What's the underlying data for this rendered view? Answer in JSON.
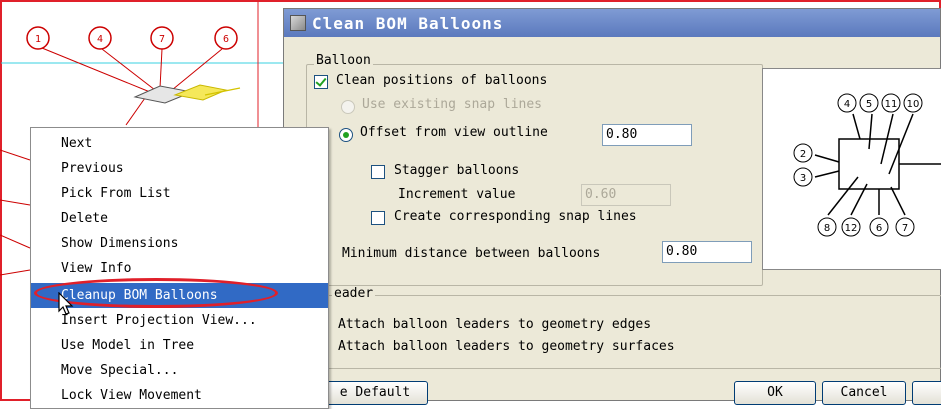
{
  "background": {
    "balloon_numbers": [
      "1",
      "4",
      "7",
      "6"
    ]
  },
  "dialog": {
    "title": "Clean BOM Balloons",
    "balloon_group": {
      "label": "Balloon",
      "clean_positions": {
        "label": "Clean positions of balloons",
        "checked": true
      },
      "use_existing_snap_lines": {
        "label": "Use existing snap lines",
        "enabled": false
      },
      "offset_from_view_outline": {
        "label": "Offset from view outline",
        "selected": true,
        "value": "0.80"
      },
      "stagger_balloons": {
        "label": "Stagger balloons",
        "checked": false
      },
      "increment_value": {
        "label": "Increment value",
        "value": "0.60",
        "enabled": false
      },
      "create_snap_lines": {
        "label": "Create corresponding snap lines",
        "checked": false
      },
      "minimum_distance": {
        "label": "Minimum distance between balloons",
        "value": "0.80"
      }
    },
    "preview": {
      "balloons_top": [
        "4",
        "5",
        "11",
        "10"
      ],
      "balloons_left": [
        "2",
        "3"
      ],
      "balloons_bottom": [
        "8",
        "12",
        "6",
        "7"
      ]
    },
    "leader_group": {
      "label": "eader",
      "attach_edges": "Attach balloon leaders to geometry edges",
      "attach_surfaces": "Attach balloon leaders to geometry surfaces"
    },
    "buttons": {
      "default": "e Default",
      "ok": "OK",
      "cancel": "Cancel"
    }
  },
  "context_menu": {
    "items": [
      {
        "label": "Next"
      },
      {
        "label": "Previous"
      },
      {
        "label": "Pick From List"
      },
      {
        "label": "Delete"
      },
      {
        "label": "Show Dimensions"
      },
      {
        "label": "View Info"
      },
      {
        "label": "Cleanup BOM Balloons",
        "highlighted": true
      },
      {
        "label": "Insert Projection View..."
      },
      {
        "label": "Use Model in Tree"
      },
      {
        "label": "Move Special..."
      },
      {
        "label": "Lock View Movement"
      }
    ]
  },
  "colors": {
    "highlight": "#316ac5",
    "annotation_red": "#e0202a",
    "title_bar": "#6a88c8",
    "dialog_bg": "#ece9d8"
  }
}
